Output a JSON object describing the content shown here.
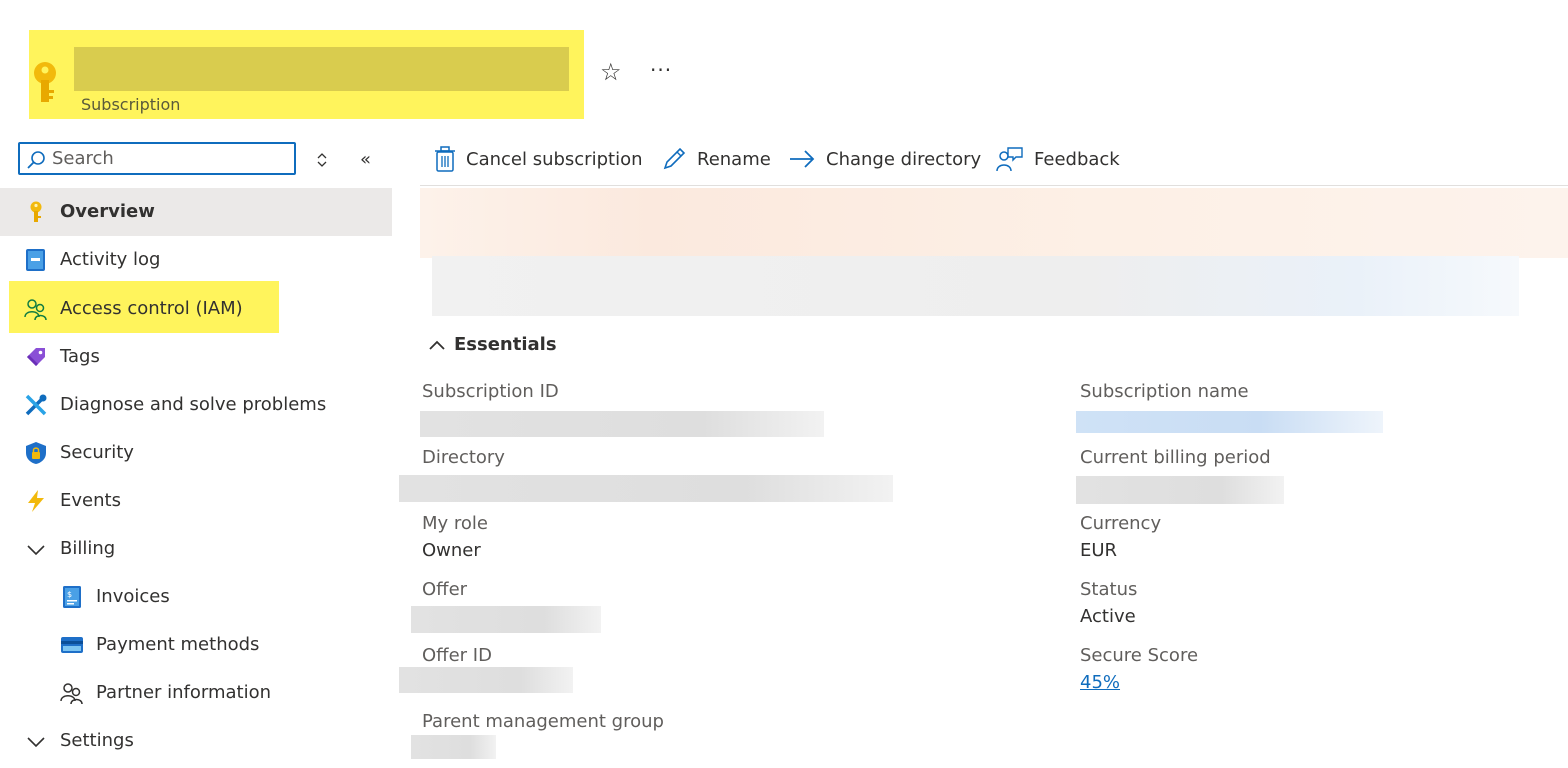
{
  "header": {
    "subtitle": "Subscription",
    "star_glyph": "☆",
    "more_glyph": "···",
    "key_icon": "key-icon"
  },
  "search": {
    "placeholder": "Search",
    "collapse_glyph": "«"
  },
  "sidebar": {
    "items": [
      {
        "label": "Overview",
        "icon": "key-icon"
      },
      {
        "label": "Activity log",
        "icon": "activity-log-icon"
      },
      {
        "label": "Access control (IAM)",
        "icon": "people-icon"
      },
      {
        "label": "Tags",
        "icon": "tag-icon"
      },
      {
        "label": "Diagnose and solve problems",
        "icon": "wrench-icon"
      },
      {
        "label": "Security",
        "icon": "shield-icon"
      },
      {
        "label": "Events",
        "icon": "lightning-icon"
      },
      {
        "label": "Billing",
        "icon": "chevron-down-icon"
      },
      {
        "label": "Invoices",
        "icon": "invoice-icon"
      },
      {
        "label": "Payment methods",
        "icon": "credit-card-icon"
      },
      {
        "label": "Partner information",
        "icon": "people-icon"
      },
      {
        "label": "Settings",
        "icon": "chevron-down-icon"
      }
    ]
  },
  "toolbar": {
    "cancel": "Cancel subscription",
    "rename": "Rename",
    "change_directory": "Change directory",
    "feedback": "Feedback"
  },
  "essentials": {
    "title": "Essentials",
    "subscription_id_label": "Subscription ID",
    "directory_label": "Directory",
    "my_role_label": "My role",
    "my_role_value": "Owner",
    "offer_label": "Offer",
    "offer_id_label": "Offer ID",
    "parent_mg_label": "Parent management group",
    "subscription_name_label": "Subscription name",
    "billing_period_label": "Current billing period",
    "currency_label": "Currency",
    "currency_value": "EUR",
    "status_label": "Status",
    "status_value": "Active",
    "secure_score_label": "Secure Score",
    "secure_score_value": "45%"
  },
  "colors": {
    "accent": "#0f6cbd",
    "highlight": "#fff45c",
    "active_bg": "#ebe9e8"
  }
}
